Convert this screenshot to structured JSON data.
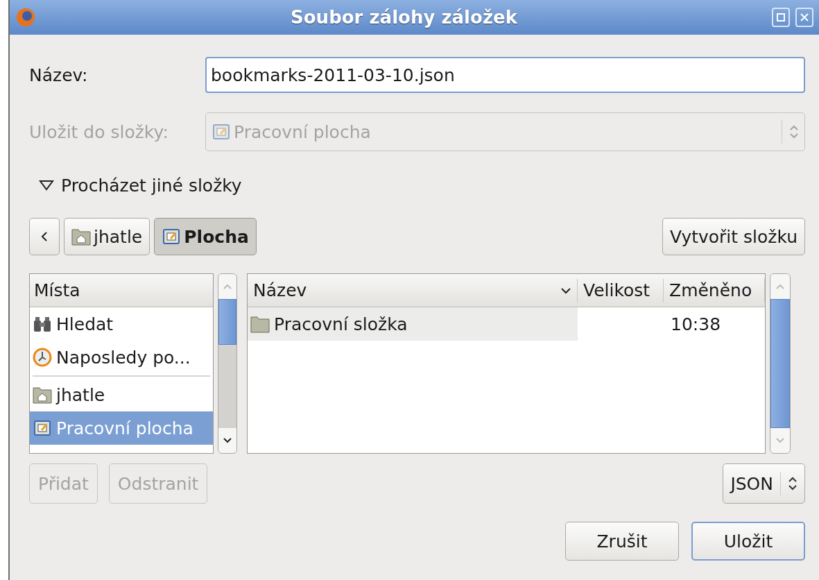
{
  "window": {
    "title": "Soubor zálohy záložek"
  },
  "name_field": {
    "label": "Název:",
    "value": "bookmarks-2011-03-10.json"
  },
  "save_in": {
    "label": "Uložit do složky:",
    "value": "Pracovní plocha",
    "disabled": true
  },
  "browse_expander": {
    "label": "Procházet jiné složky",
    "expanded": true
  },
  "path_bar": [
    {
      "label": "jhatle",
      "kind": "home",
      "selected": false
    },
    {
      "label": "Plocha",
      "kind": "desktop",
      "selected": true
    }
  ],
  "create_folder_button": "Vytvořit složku",
  "places": {
    "header": "Místa",
    "sections": [
      {
        "items": [
          {
            "label": "Hledat",
            "kind": "search",
            "selected": false
          },
          {
            "label": "Naposledy po...",
            "kind": "recent",
            "selected": false
          }
        ]
      },
      {
        "items": [
          {
            "label": "jhatle",
            "kind": "home",
            "selected": false
          },
          {
            "label": "Pracovní plocha",
            "kind": "desktop",
            "selected": true
          }
        ]
      }
    ]
  },
  "files": {
    "columns": [
      {
        "label": "Název",
        "sorted": true
      },
      {
        "label": "Velikost",
        "sorted": false
      },
      {
        "label": "Změněno",
        "sorted": false
      }
    ],
    "rows": [
      {
        "name": "Pracovní složka",
        "modified": "10:38"
      }
    ]
  },
  "add_button": {
    "label": "Přidat",
    "disabled": true
  },
  "remove_button": {
    "label": "Odstranit",
    "disabled": true
  },
  "filter": {
    "value": "JSON"
  },
  "buttons": [
    {
      "label": "Zrušit",
      "default": false
    },
    {
      "label": "Uložit",
      "default": true
    }
  ]
}
